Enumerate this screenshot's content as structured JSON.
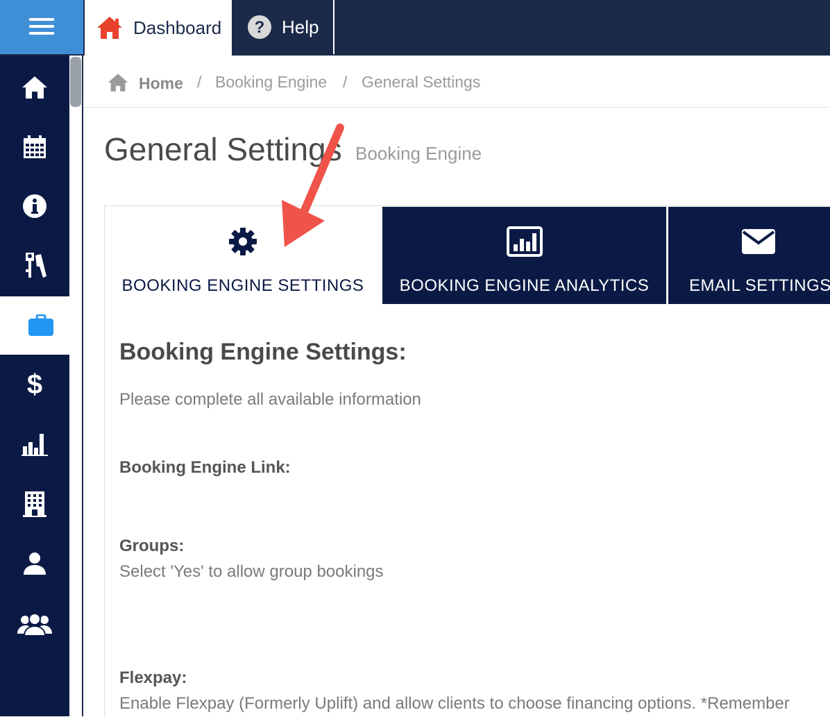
{
  "topnav": {
    "dashboard_label": "Dashboard",
    "help_label": "Help",
    "dashboard_icon": "home-icon",
    "help_icon": "question-circle-icon",
    "menu_icon": "hamburger-icon"
  },
  "sidebar": {
    "items": [
      {
        "icon": "home-icon"
      },
      {
        "icon": "calendar-icon"
      },
      {
        "icon": "info-icon"
      },
      {
        "icon": "keys-icon"
      },
      {
        "icon": "briefcase-icon",
        "active": true
      },
      {
        "icon": "dollar-icon"
      },
      {
        "icon": "bar-chart-icon"
      },
      {
        "icon": "building-icon"
      },
      {
        "icon": "user-icon"
      },
      {
        "icon": "users-icon"
      }
    ]
  },
  "breadcrumb": {
    "home": "Home",
    "separator": "/",
    "items": [
      "Booking Engine",
      "General Settings"
    ]
  },
  "page": {
    "title": "General Settings",
    "subtitle": "Booking Engine"
  },
  "tabs": [
    {
      "label": "BOOKING ENGINE SETTINGS",
      "icon": "gear-icon",
      "active": true
    },
    {
      "label": "BOOKING ENGINE ANALYTICS",
      "icon": "analytics-chart-icon",
      "active": false
    },
    {
      "label": "EMAIL SETTINGS",
      "icon": "envelope-icon",
      "active": false
    }
  ],
  "section": {
    "title": "Booking Engine Settings:",
    "description": "Please complete all available information"
  },
  "fields": {
    "link_label": "Booking Engine Link:",
    "groups_label": "Groups:",
    "groups_help": "Select 'Yes' to allow group bookings",
    "flexpay_label": "Flexpay:",
    "flexpay_help": "Enable Flexpay (Formerly Uplift) and allow clients to choose financing options. *Remember"
  },
  "colors": {
    "navy": "#0b1a45",
    "topbar": "#1c2a4a",
    "accent_blue": "#3f8fd6",
    "home_red": "#e8412c",
    "arrow": "#f0534a"
  }
}
